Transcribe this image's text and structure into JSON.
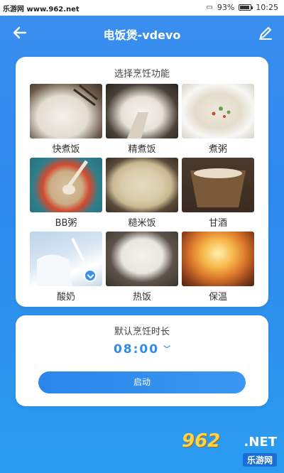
{
  "statusbar": {
    "watermark": "乐游网 www.962.net",
    "battery_pct": "93%",
    "time": "10:25"
  },
  "appbar": {
    "title": "电饭煲-vdevo"
  },
  "functions": {
    "heading": "选择烹饪功能",
    "items": [
      {
        "label": "快煮饭",
        "icon": "quick-rice"
      },
      {
        "label": "精煮饭",
        "icon": "fine-rice"
      },
      {
        "label": "煮粥",
        "icon": "porridge"
      },
      {
        "label": "BB粥",
        "icon": "baby-porridge"
      },
      {
        "label": "糙米饭",
        "icon": "brown-rice"
      },
      {
        "label": "甘酒",
        "icon": "sweet-wine"
      },
      {
        "label": "酸奶",
        "icon": "yogurt",
        "selected": true
      },
      {
        "label": "热饭",
        "icon": "reheat"
      },
      {
        "label": "保温",
        "icon": "keep-warm"
      }
    ]
  },
  "duration": {
    "heading": "默认烹饪时长",
    "time": "08:00",
    "start_label": "启动"
  },
  "footer_logo": {
    "number": "962",
    "domain": ".NET",
    "name": "乐游网"
  },
  "colors": {
    "accent": "#2f8bec",
    "card": "#ffffff"
  }
}
